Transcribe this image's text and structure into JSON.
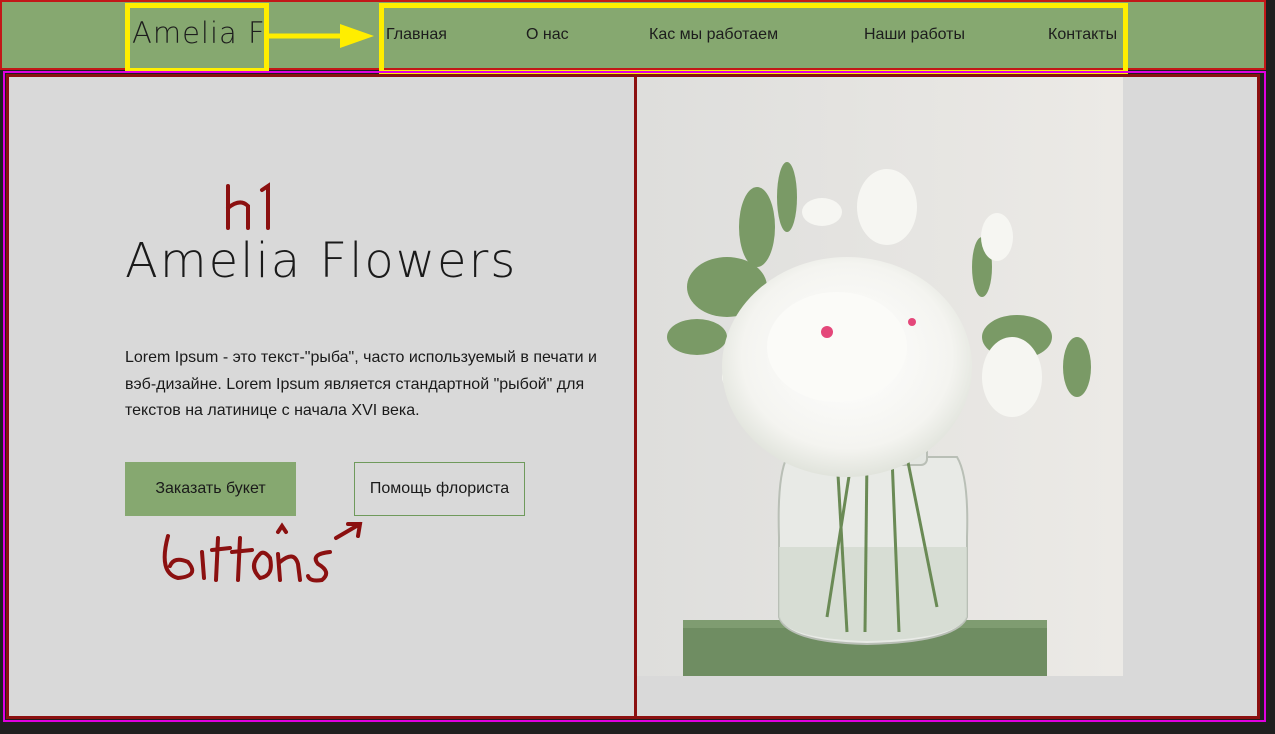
{
  "header": {
    "logo_text": "Amelia F",
    "nav": [
      {
        "label": "Главная"
      },
      {
        "label": "О нас"
      },
      {
        "label": "Кас мы работаем"
      },
      {
        "label": "Наши работы"
      },
      {
        "label": "Контакты"
      }
    ]
  },
  "hero": {
    "title": "Amelia Flowers",
    "description": "Lorem Ipsum - это текст-\"рыба\", часто используемый в печати и вэб-дизайне. Lorem Ipsum является стандартной \"рыбой\" для текстов на латинице с начала XVI века.",
    "primary_button": "Заказать букет",
    "secondary_button": "Помощь флориста",
    "image": {
      "icon": "flower-vase-photo"
    }
  },
  "annotations": {
    "h1_note": "h1",
    "buttons_note": "buttons"
  },
  "colors": {
    "header_bg": "#86a870",
    "hero_bg": "#d9d9d9",
    "annotation_yellow": "#ffee00",
    "annotation_red": "#8b1010",
    "outline_magenta": "#e000e0"
  }
}
